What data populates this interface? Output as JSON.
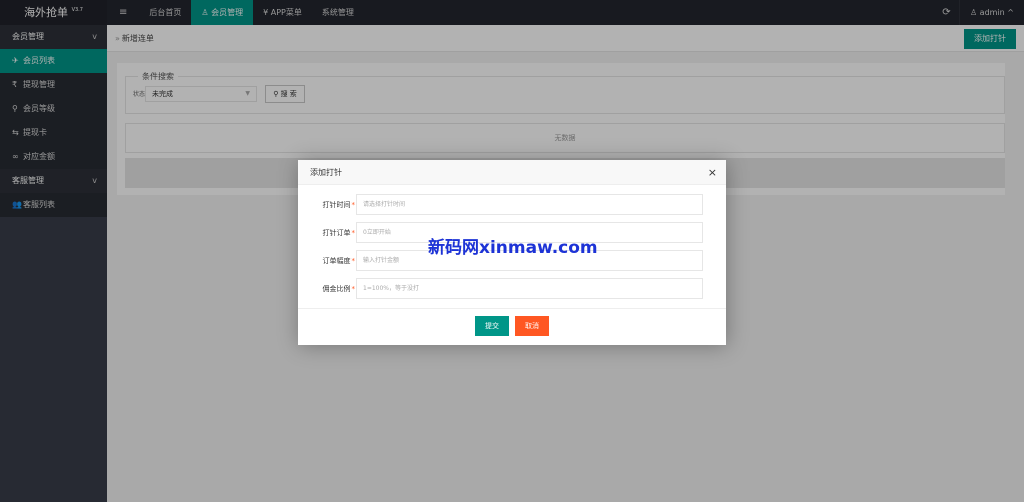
{
  "header": {
    "app_title": "海外抢单",
    "version": "V3.7",
    "nav": [
      {
        "label": "≡"
      },
      {
        "label": "后台首页"
      },
      {
        "label": "会员管理"
      },
      {
        "label": "APP菜单"
      },
      {
        "label": "系统管理"
      }
    ],
    "nav_icons": {
      "members": "user-icon",
      "app": "yen-icon"
    },
    "refresh_icon": "⟳",
    "user": "admin",
    "user_chevron": "^"
  },
  "sidebar": {
    "groups": [
      {
        "label": "会员管理",
        "chevron": "v",
        "items": [
          {
            "label": "会员列表",
            "icon": "✈"
          },
          {
            "label": "提现管理",
            "icon": "₹"
          },
          {
            "label": "会员等级",
            "icon": "⚲"
          },
          {
            "label": "提现卡",
            "icon": "⇆"
          },
          {
            "label": "对应金额",
            "icon": "∞"
          }
        ]
      },
      {
        "label": "客服管理",
        "chevron": "v",
        "items": [
          {
            "label": "客服列表",
            "icon": "👥"
          }
        ]
      }
    ]
  },
  "main": {
    "breadcrumb_sep": "»",
    "breadcrumb": "新增连单",
    "add_button": "添加打针",
    "search": {
      "legend": "条件搜索",
      "status_label": "状态",
      "status_value": "未完成",
      "button": "搜 索"
    },
    "table_empty": "无数据"
  },
  "modal": {
    "title": "添加打针",
    "close": "×",
    "fields": [
      {
        "label": "打针时间",
        "required": "*",
        "placeholder": "请选择打针时间"
      },
      {
        "label": "打针订单",
        "required": "*",
        "placeholder": "0立即开始"
      },
      {
        "label": "订单幅度",
        "required": "*",
        "placeholder": "输入打针金额"
      },
      {
        "label": "佣金比例",
        "required": "*",
        "placeholder": "1=100%，等于没打"
      }
    ],
    "submit": "提交",
    "cancel": "取消"
  },
  "watermark": "新码网xinmaw.com",
  "colors": {
    "accent": "#009688",
    "danger": "#ff5722",
    "header": "#23262e",
    "sidebar": "#393d49"
  }
}
